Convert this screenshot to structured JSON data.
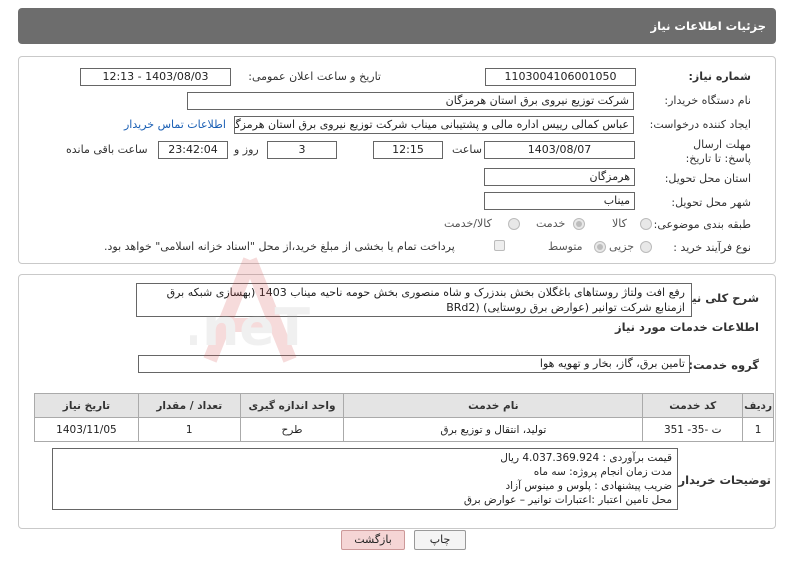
{
  "header": {
    "title": "جزئیات اطلاعات نیاز"
  },
  "form": {
    "need_number_label": "شماره نیاز:",
    "need_number": "1103004106001050",
    "announce_label": "تاریخ و ساعت اعلان عمومی:",
    "announce_value": "1403/08/03 - 12:13",
    "buyer_label": "نام دستگاه خریدار:",
    "buyer_value": "شرکت توزیع نیروی برق استان هرمزگان",
    "creator_label": "ایجاد کننده درخواست:",
    "creator_value": "عباس کمالی رییس اداره مالی و پشتیبانی میناب شرکت توزیع نیروی برق استان هرمزگان",
    "contact_link": "اطلاعات تماس خریدار",
    "deadline_label": "مهلت ارسال پاسخ: تا تاریخ:",
    "deadline_date": "1403/08/07",
    "time_label": "ساعت",
    "deadline_time": "12:15",
    "days_value": "3",
    "days_label": "روز و",
    "remaining_time": "23:42:04",
    "remaining_label": "ساعت باقی مانده",
    "province_label": "استان محل تحویل:",
    "province_value": "هرمزگان",
    "city_label": "شهر محل تحویل:",
    "city_value": "میناب",
    "category_label": "طبقه بندی موضوعی:",
    "category_options": [
      "کالا",
      "خدمت",
      "کالا/خدمت"
    ],
    "process_label": "نوع فرآیند خرید :",
    "process_options": [
      "جزیی",
      "متوسط"
    ],
    "payment_note": "پرداخت تمام یا بخشی از مبلغ خرید،از محل \"اسناد خزانه اسلامی\" خواهد بود."
  },
  "summary": {
    "label": "شرح کلی نیاز:",
    "text": "رفع  افت ولتاژ روستاهای باغگلان بخش بندزرک و شاه منصوری بخش حومه ناحیه میناب 1403 (بهسازی شبکه برق ازمنابع شرکت توانیر (عوارض برق روستایی)  (BRd2"
  },
  "services": {
    "section_title": "اطلاعات خدمات مورد نیاز",
    "group_label": "گروه خدمت:",
    "group_value": "تامین برق، گاز، بخار و تهویه هوا",
    "columns": [
      "ردیف",
      "کد خدمت",
      "نام خدمت",
      "واحد اندازه گیری",
      "تعداد / مقدار",
      "تاریخ نیاز"
    ],
    "rows": [
      [
        "1",
        "ت -35- 351",
        "تولید، انتقال و توزیع برق",
        "طرح",
        "1",
        "1403/11/05"
      ]
    ]
  },
  "buyer_notes": {
    "label": "توضیحات خریدار:",
    "lines": [
      "قیمت برآوردی : 4.037.369.924 ریال",
      "مدت زمان انجام پروژه: سه ماه",
      "ضریب پیشنهادی : پلوس و مینوس آزاد",
      "محل تامین اعتبار :اعتبارات توانیر – عوارض برق"
    ]
  },
  "buttons": {
    "print": "چاپ",
    "back": "بازگشت"
  },
  "watermark_text": "AriaTender.neT",
  "colors": {
    "header_bg": "#6d6d6d",
    "back_btn_bg": "#f5d5d5",
    "link": "#1a5fb4"
  }
}
